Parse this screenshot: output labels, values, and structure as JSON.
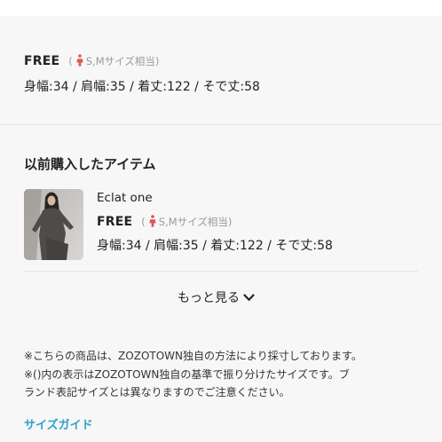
{
  "current_size": {
    "name": "FREE",
    "paren_open": "(",
    "equivalent": "S,Mサイズ相当)",
    "dimensions": "身幅:34 / 肩幅:35 / 着丈:122 / そで丈:58"
  },
  "previous_purchases": {
    "title": "以前購入したアイテム",
    "items": [
      {
        "name": "Eclat one",
        "size": "FREE",
        "paren_open": "(",
        "equivalent": "S,Mサイズ相当)",
        "dimensions": "身幅:34 / 肩幅:35 / 着丈:122 / そで丈:58"
      }
    ],
    "more_label": "もっと見る"
  },
  "notes": {
    "line1": "※こちらの商品は、ZOZOTOWN独自の方法により採寸しております。",
    "line2": "※()内の表示はZOZOTOWN独自の基準で振り分けたサイズです。ブ",
    "line3": "ランド表記サイズとは異なりますのでご注意ください。"
  },
  "size_guide_label": "サイズガイド",
  "colors": {
    "background": "#f7f7f7",
    "link": "#2fa3c8",
    "female_icon": "#e05555",
    "muted_text": "#9a9a9a"
  },
  "icons": {
    "female": "female-person-icon",
    "more": "chevron-down-icon"
  }
}
